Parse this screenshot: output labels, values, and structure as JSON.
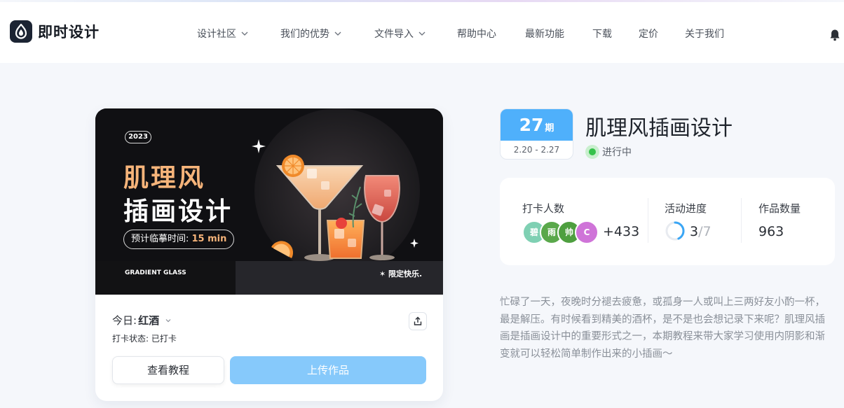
{
  "app": {
    "name": "即时设计"
  },
  "nav": {
    "items": [
      {
        "label": "设计社区",
        "dropdown": true
      },
      {
        "label": "我们的优势",
        "dropdown": true
      },
      {
        "label": "文件导入",
        "dropdown": true
      },
      {
        "label": "帮助中心",
        "dropdown": false
      },
      {
        "label": "最新功能",
        "dropdown": false
      },
      {
        "label": "下载",
        "dropdown": false
      },
      {
        "label": "定价",
        "dropdown": false
      },
      {
        "label": "关于我们",
        "dropdown": false
      }
    ]
  },
  "banner": {
    "year": "2023",
    "title_line1": "肌理风",
    "title_line2": "插画设计",
    "time_label": "预计临摹时间: ",
    "time_value": "15 min",
    "footer_left": "GRADIENT GLASS",
    "footer_right": "✶ 限定快乐."
  },
  "card": {
    "today_label": "今日:",
    "today_value": "红酒",
    "checkin_status": "打卡状态: 已打卡",
    "tutorial_button": "查看教程",
    "upload_button": "上传作品"
  },
  "issue": {
    "number": "27",
    "unit": "期",
    "date_range": "2.20 - 2.27"
  },
  "topic": {
    "title": "肌理风插画设计",
    "status": "进行中"
  },
  "stats": {
    "checkin_label": "打卡人数",
    "avatars": [
      {
        "text": "碧",
        "color": "#7fd0b3"
      },
      {
        "text": "雨",
        "color": "#5aa84b"
      },
      {
        "text": "帅",
        "color": "#4e9f3f"
      },
      {
        "text": "C",
        "color": "#cf74d8"
      }
    ],
    "checkin_extra": "+433",
    "progress_label": "活动进度",
    "progress_current": "3",
    "progress_total": "/7",
    "progress_fraction": 0.43,
    "works_label": "作品数量",
    "works_count": "963"
  },
  "description": "忙碌了一天，夜晚时分褪去疲惫，或孤身一人或叫上三两好友小酌一杯，最是解压。有时候看到精美的酒杯，是不是也会想记录下来呢？肌理风插画是插画设计中的重要形式之一，本期教程来带大家学习使用内阴影和渐变就可以轻松简单制作出来的小插画～",
  "colors": {
    "accent_blue": "#4fb0fb",
    "upload_button": "#86c9fb",
    "status_green": "#35c24b",
    "title_orange": "#f6b47a"
  }
}
